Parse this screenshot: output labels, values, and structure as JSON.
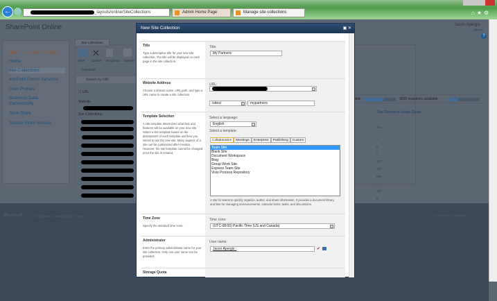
{
  "browser": {
    "url_suffix": "_layouts/online/SiteCollections",
    "tabs": [
      "Admin Home Page",
      "Manage site collections"
    ]
  },
  "header": {
    "logo": "SharePoint Online",
    "user": "Jason Apergis",
    "sign_out": "sign out",
    "help": "?"
  },
  "leftnav": {
    "heading": "administration center",
    "items": [
      "Home",
      "Site Collections",
      "InfoPath Forms Services",
      "User Profiles",
      "Business Data Connectivity",
      "Term Store",
      "Secure Store Service"
    ]
  },
  "main": {
    "tab": "Site Collections",
    "ribbon": [
      "New",
      "Delete",
      "Properties",
      "Owners"
    ],
    "group": "Contribute",
    "search": "Search by URL",
    "url_col": "URL",
    "website": "Website",
    "site_collections": "Site Collections",
    "resources_left": "lable",
    "resources_available": "3600 resources available",
    "resources_fill": 0.3,
    "left_fill": 0.6,
    "quota_header": "Total Resource Usage Quota",
    "quota_values": [
      "300",
      "0",
      "0",
      "0",
      "100",
      "300",
      "600",
      "0",
      "400",
      "0",
      "0"
    ]
  },
  "footer": {
    "brand": "Microsoft",
    "copyright": "© 2010 Microsoft Corporation   Legal   |   Privacy",
    "right": "Community   |   Feedback"
  },
  "dialog": {
    "title": "New Site Collection",
    "title_section": {
      "heading": "Title",
      "desc": "Type a descriptive title for your new site collection. The title will be displayed on each page in the site collection.",
      "label": "Title:",
      "value": "My Partners"
    },
    "address": {
      "heading": "Website Address",
      "desc": "Choose a domain name, URL path, and type a URL name to create a site collection.",
      "label": "URL:",
      "path": "/sites/",
      "name": "mypartners"
    },
    "template": {
      "heading": "Template Selection",
      "desc": "A site template determines what lists and features will be available on your new site. Select a site template based on the descriptions of each template and how you intend to use the new site. Many aspects of a site can be customized after creation. However, the site template cannot be changed once the site is created.",
      "lang_label": "Select a language:",
      "language": "English",
      "tmpl_label": "Select a template:",
      "tabs": [
        "Collaboration",
        "Meetings",
        "Enterprise",
        "Publishing",
        "Custom"
      ],
      "items": [
        "Team Site",
        "Blank Site",
        "Document Workspace",
        "Blog",
        "Group Work Site",
        "Express Team Site",
        "Visio Process Repository"
      ],
      "description": "A site for teams to quickly organize, author, and share information. It provides a document library, and lists for managing announcements, calendar items, tasks, and discussions."
    },
    "timezone": {
      "heading": "Time Zone",
      "desc": "Specify the standard time zone.",
      "label": "Time zone:",
      "value": "(UTC-08:00) Pacific Time (US and Canada)"
    },
    "admin": {
      "heading": "Administrator",
      "desc": "Enter the primary administrator name for your site collection. Only one user name can be provided.",
      "label": "User name:",
      "value": "Jason Apergis ;"
    },
    "storage": {
      "heading": "Storage Quota"
    }
  }
}
